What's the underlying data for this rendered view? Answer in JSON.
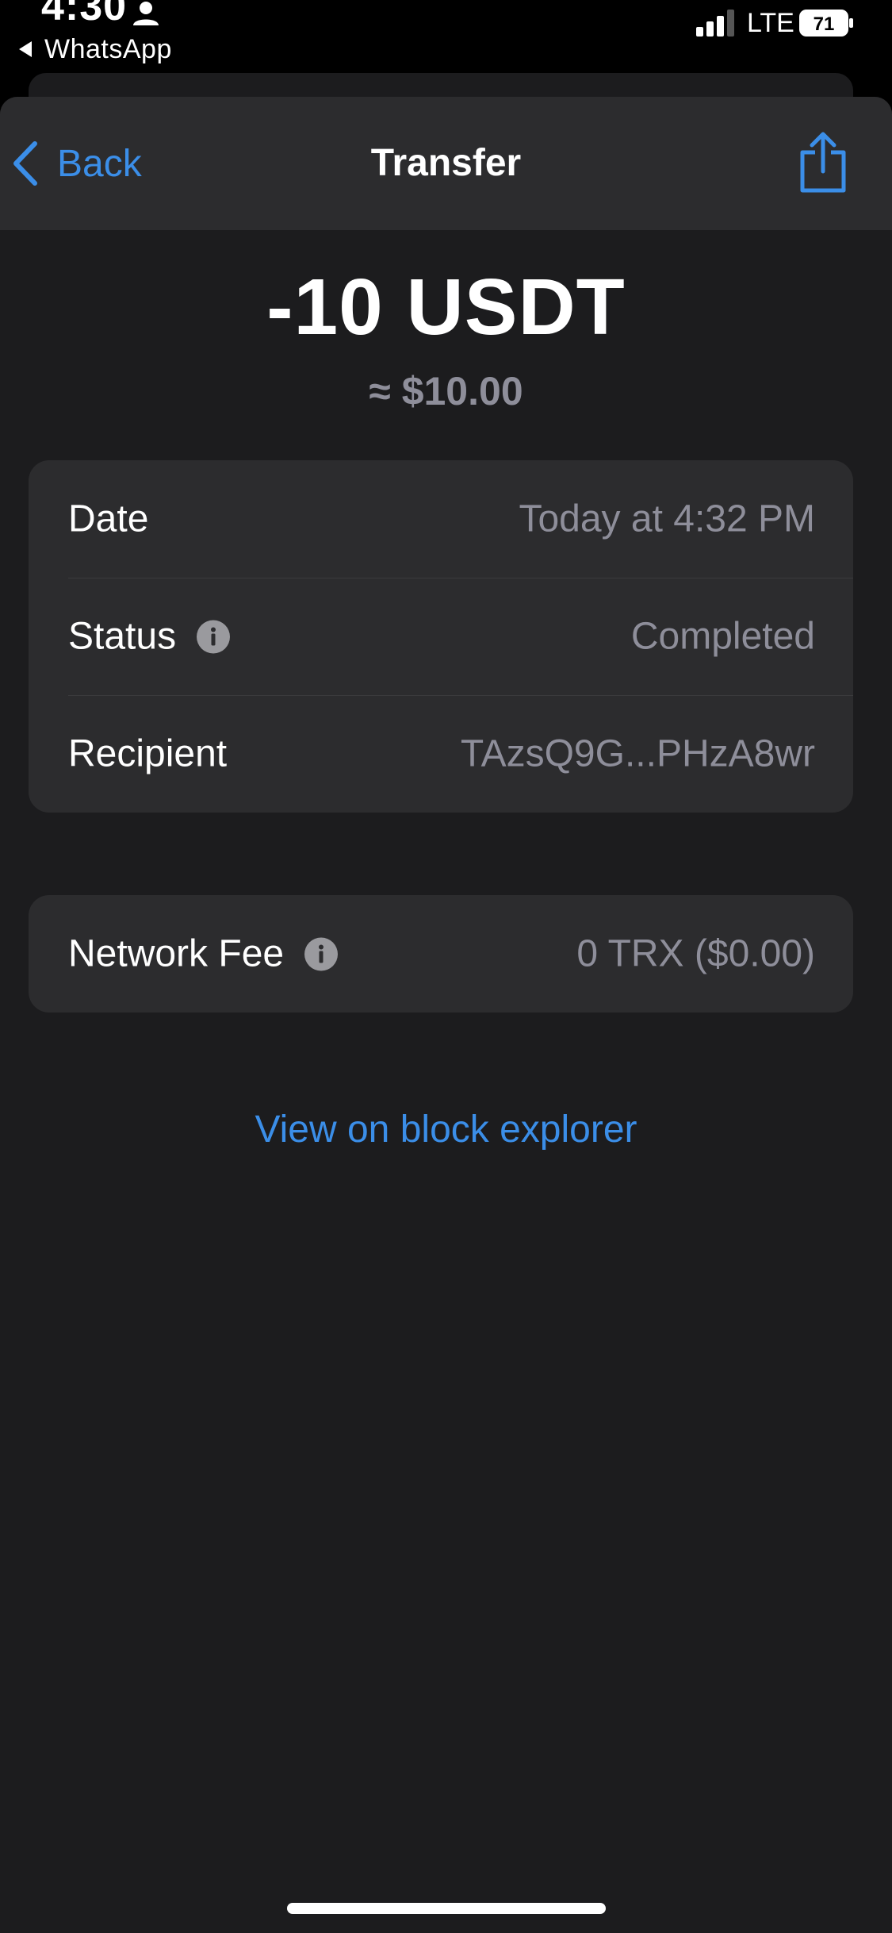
{
  "status_bar": {
    "time": "4:30",
    "back_app": "WhatsApp",
    "network": "LTE",
    "battery": "71"
  },
  "nav": {
    "back_label": "Back",
    "title": "Transfer"
  },
  "amount": {
    "value": "-10 USDT",
    "fiat": "≈ $10.00"
  },
  "details": [
    {
      "label": "Date",
      "value": "Today at 4:32 PM"
    },
    {
      "label": "Status",
      "value": "Completed"
    },
    {
      "label": "Recipient",
      "value": "TAzsQ9G...PHzA8wr"
    }
  ],
  "fee": {
    "label": "Network Fee",
    "value": "0 TRX ($0.00)"
  },
  "explorer_link": "View on block explorer",
  "colors": {
    "accent": "#3b8ee8",
    "background": "#1c1c1e",
    "card": "#2c2c2e",
    "secondary_text": "#8e8e9a"
  },
  "icons": [
    "back-chevron-icon",
    "share-icon",
    "info-icon",
    "person-icon",
    "signal-icon",
    "battery-icon"
  ]
}
